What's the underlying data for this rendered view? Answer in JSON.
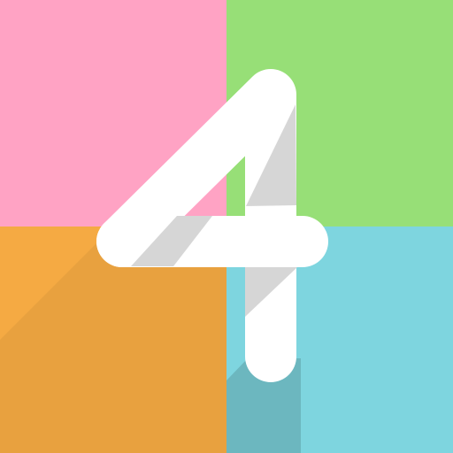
{
  "icon": {
    "glyph": "4",
    "name": "number-four-app-icon",
    "colors": {
      "tile_top_left": "#ffa3c4",
      "tile_top_right": "#97df77",
      "tile_bottom_left": "#f5aa43",
      "tile_bottom_right": "#7ed5df",
      "glyph_fill": "#ffffff",
      "glyph_fold_shade": "#d6d6d6",
      "long_shadow": "#000000"
    }
  }
}
